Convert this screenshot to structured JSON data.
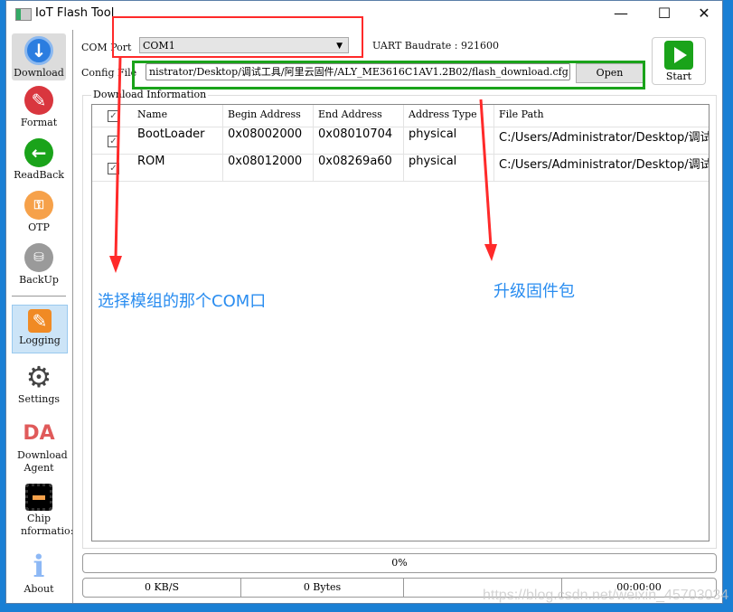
{
  "window": {
    "title": "IoT Flash Tool",
    "minimize": "—",
    "maximize": "☐",
    "close": "✕"
  },
  "sidebar": {
    "items": [
      {
        "label": "Download",
        "icon": "download-icon",
        "color": "#2b7de0"
      },
      {
        "label": "Format",
        "icon": "eraser-icon",
        "color": "#d9363e"
      },
      {
        "label": "ReadBack",
        "icon": "arrow-left-icon",
        "color": "#1aa31a"
      },
      {
        "label": "OTP",
        "icon": "otp-lock-icon",
        "color": "#f6a14a"
      },
      {
        "label": "BackUp",
        "icon": "backup-icon",
        "color": "#9a9a9a"
      },
      {
        "label": "Logging",
        "icon": "pencil-icon",
        "color": "#f08a24"
      },
      {
        "label": "Settings",
        "icon": "gear-icon",
        "color": "#444444"
      },
      {
        "label": "Download Agent",
        "icon": "da-icon",
        "icon_text": "DA",
        "color": "#e05a5a"
      },
      {
        "label": "Chip nformatio:",
        "icon": "chip-icon",
        "color": "#000000"
      },
      {
        "label": "About",
        "icon": "info-icon",
        "color": "#8db8f5"
      }
    ]
  },
  "form": {
    "com_port_label": "COM Port",
    "com_port_value": "COM1",
    "uart_label": "UART Baudrate : 921600",
    "config_label": "Config File",
    "config_value": "nistrator/Desktop/调试工具/阿里云固件/ALY_ME3616C1AV1.2B02/flash_download.cfg",
    "open_label": "Open",
    "start_label": "Start"
  },
  "download_info": {
    "title": "Download Information",
    "columns": [
      "Name",
      "Begin Address",
      "End Address",
      "Address Type",
      "File Path"
    ],
    "rows": [
      {
        "checked": true,
        "name": "BootLoader",
        "begin": "0x08002000",
        "end": "0x08010704",
        "type": "physical",
        "path": "C:/Users/Administrator/Desktop/调试..."
      },
      {
        "checked": true,
        "name": "ROM",
        "begin": "0x08012000",
        "end": "0x08269a60",
        "type": "physical",
        "path": "C:/Users/Administrator/Desktop/调试..."
      }
    ]
  },
  "progress": {
    "percent": 0,
    "label": "0%"
  },
  "status": {
    "speed": "0 KB/S",
    "bytes": "0 Bytes",
    "blank": "",
    "time": "00:00:00"
  },
  "annotations": {
    "com_note": "选择模组的那个COM口",
    "firmware_note": "升级固件包",
    "red": "#ff2a2a",
    "green": "#1aa31a",
    "text_color": "#2a8df0"
  },
  "watermark": "https://blog.csdn.net/weixin_45703034"
}
